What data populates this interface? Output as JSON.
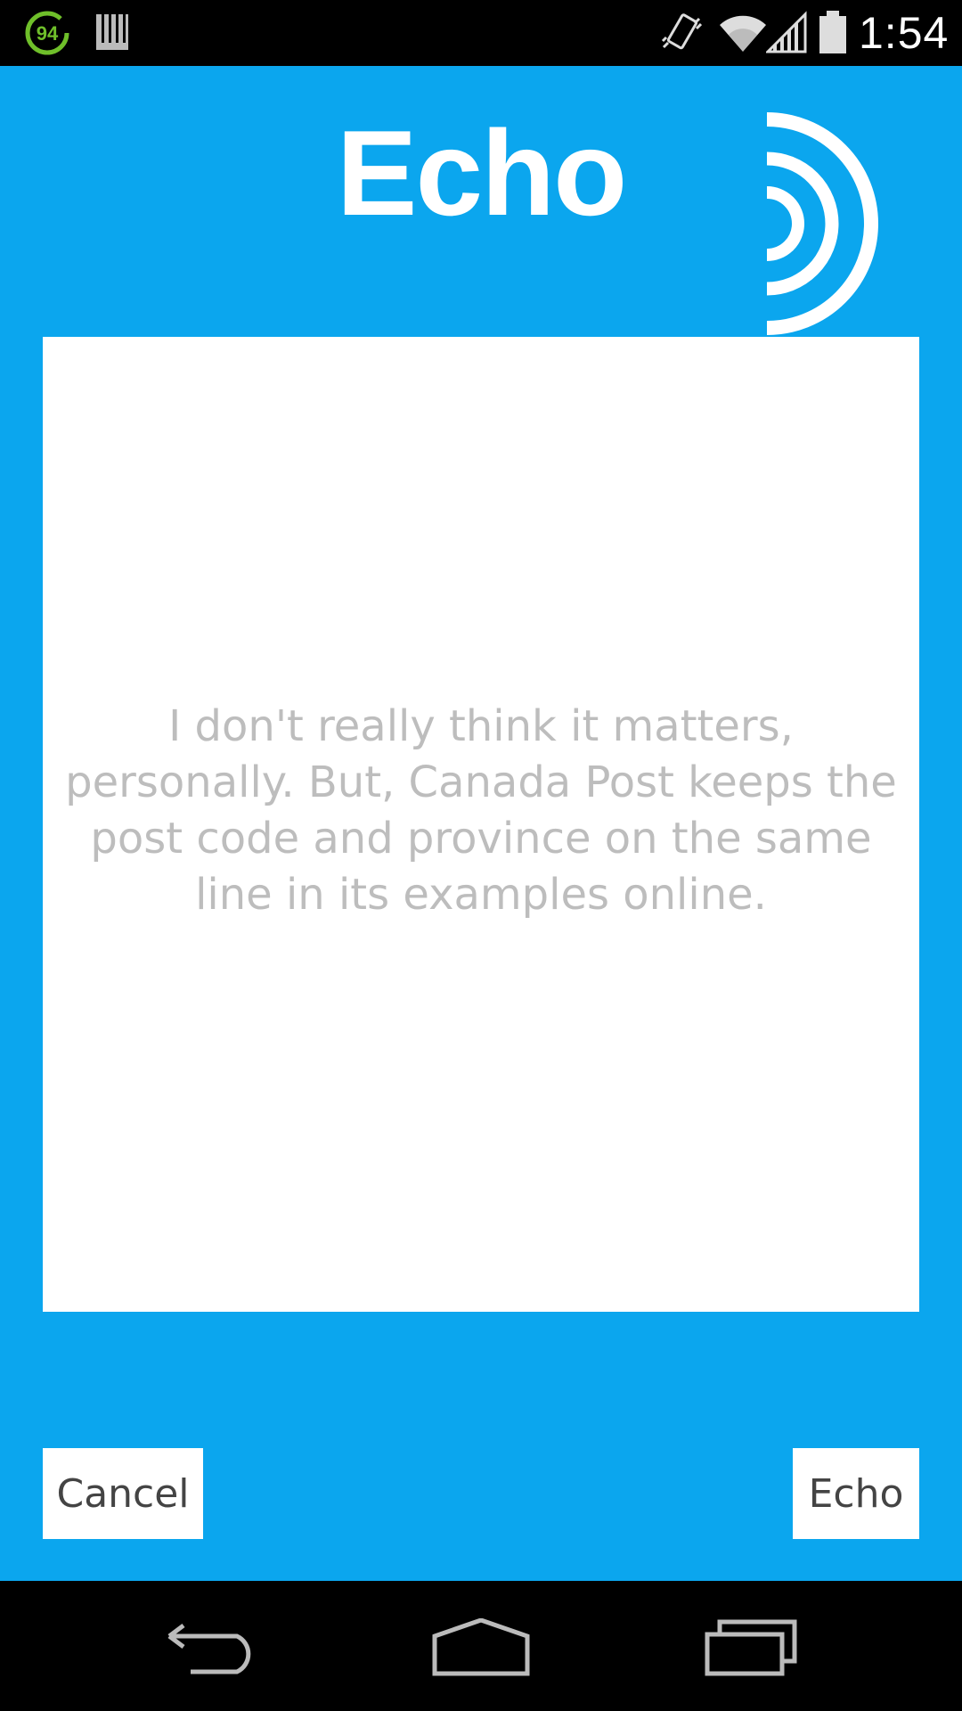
{
  "status_bar": {
    "battery_saver_level": "94",
    "time": "1:54",
    "icons": [
      "battery-circle-icon",
      "sd-card-icon",
      "vibrate-icon",
      "wifi-icon",
      "signal-icon",
      "battery-icon"
    ]
  },
  "app": {
    "title": "Echo",
    "logo_icon": "echo-waves-icon",
    "message": "I don't really think it matters, personally. But, Canada Post keeps the post code and province on the same line in its examples online.",
    "cancel_label": "Cancel",
    "echo_label": "Echo",
    "colors": {
      "background": "#0ba6ee",
      "message_text": "#bdbdbd",
      "button_text": "#444444"
    }
  },
  "nav_bar": {
    "icons": [
      "back-icon",
      "home-icon",
      "recents-icon"
    ]
  }
}
